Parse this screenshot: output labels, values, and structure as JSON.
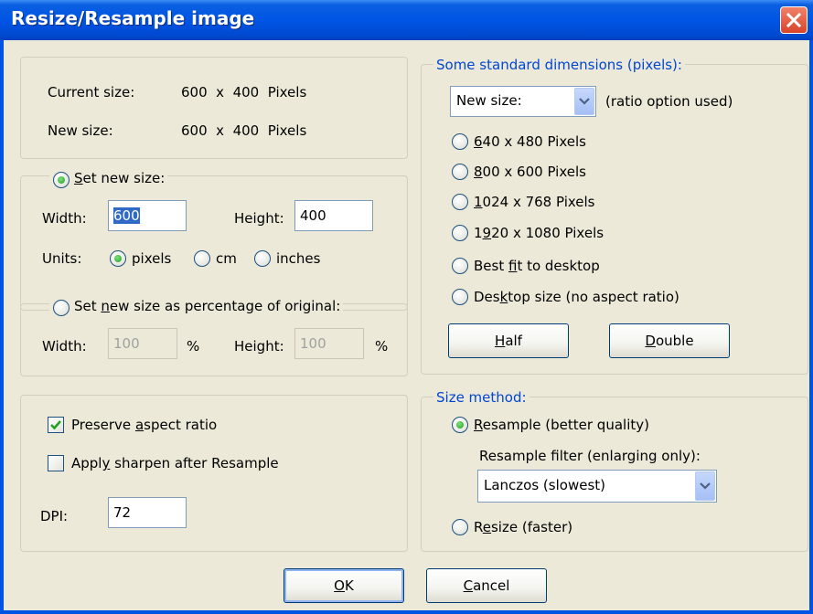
{
  "window": {
    "title": "Resize/Resample image",
    "close_icon": "close-icon"
  },
  "current": {
    "label": "Current size:",
    "value": "600  x  400  Pixels"
  },
  "new_size": {
    "label": "New size:",
    "value": "600  x  400  Pixels"
  },
  "set_new_size": {
    "legend_hotkey": "S",
    "legend_rest": "et new size:",
    "selected": true,
    "width_label": "Width:",
    "width_value": "600",
    "height_label": "Height:",
    "height_value": "400",
    "units_label": "Units:",
    "units": [
      {
        "label": "pixels",
        "selected": true
      },
      {
        "label": "cm",
        "selected": false
      },
      {
        "label": "inches",
        "selected": false
      }
    ]
  },
  "percentage": {
    "legend_before": "Set ",
    "legend_hotkey": "n",
    "legend_after": "ew size as percentage of original:",
    "selected": false,
    "width_label": "Width:",
    "width_value": "100",
    "width_unit": "%",
    "height_label": "Height:",
    "height_value": "100",
    "height_unit": "%"
  },
  "options": {
    "preserve": {
      "before": "Preserve ",
      "hotkey": "a",
      "after": "spect ratio",
      "checked": true
    },
    "sharpen": {
      "before": "Appl",
      "hotkey": "y",
      "after": " sharpen after Resample",
      "checked": false
    },
    "dpi_label": "DPI:",
    "dpi_value": "72"
  },
  "standard": {
    "legend": "Some standard dimensions (pixels):",
    "combo_value": "New size:",
    "combo_note": "(ratio option used)",
    "options": [
      {
        "hotkey": "6",
        "rest": "40 x 480 Pixels"
      },
      {
        "hotkey": "8",
        "rest": "00 x 600 Pixels"
      },
      {
        "hotkey": "1",
        "rest": "024 x 768 Pixels"
      },
      {
        "before": "1",
        "hotkey": "9",
        "rest": "20 x 1080 Pixels"
      },
      {
        "before": "Best ",
        "hotkey": "f",
        "rest": "it to desktop"
      },
      {
        "before": "Des",
        "hotkey": "k",
        "rest": "top size (no aspect ratio)"
      }
    ],
    "half": {
      "hotkey": "H",
      "rest": "alf"
    },
    "double": {
      "hotkey": "D",
      "rest": "ouble"
    }
  },
  "method": {
    "legend": "Size method:",
    "resample": {
      "hotkey": "R",
      "rest": "esample (better quality)",
      "selected": true
    },
    "filter_label": "Resample filter (enlarging only):",
    "filter_value": "Lanczos (slowest)",
    "resize": {
      "before": "R",
      "hotkey": "e",
      "rest": "size (faster)",
      "selected": false
    }
  },
  "buttons": {
    "ok": {
      "hotkey": "O",
      "rest": "K"
    },
    "cancel": {
      "hotkey": "C",
      "rest": "ancel"
    }
  },
  "colors": {
    "title_bar": "#0055e5",
    "dialog_bg": "#ece9d8",
    "group_title": "#0046d5"
  }
}
